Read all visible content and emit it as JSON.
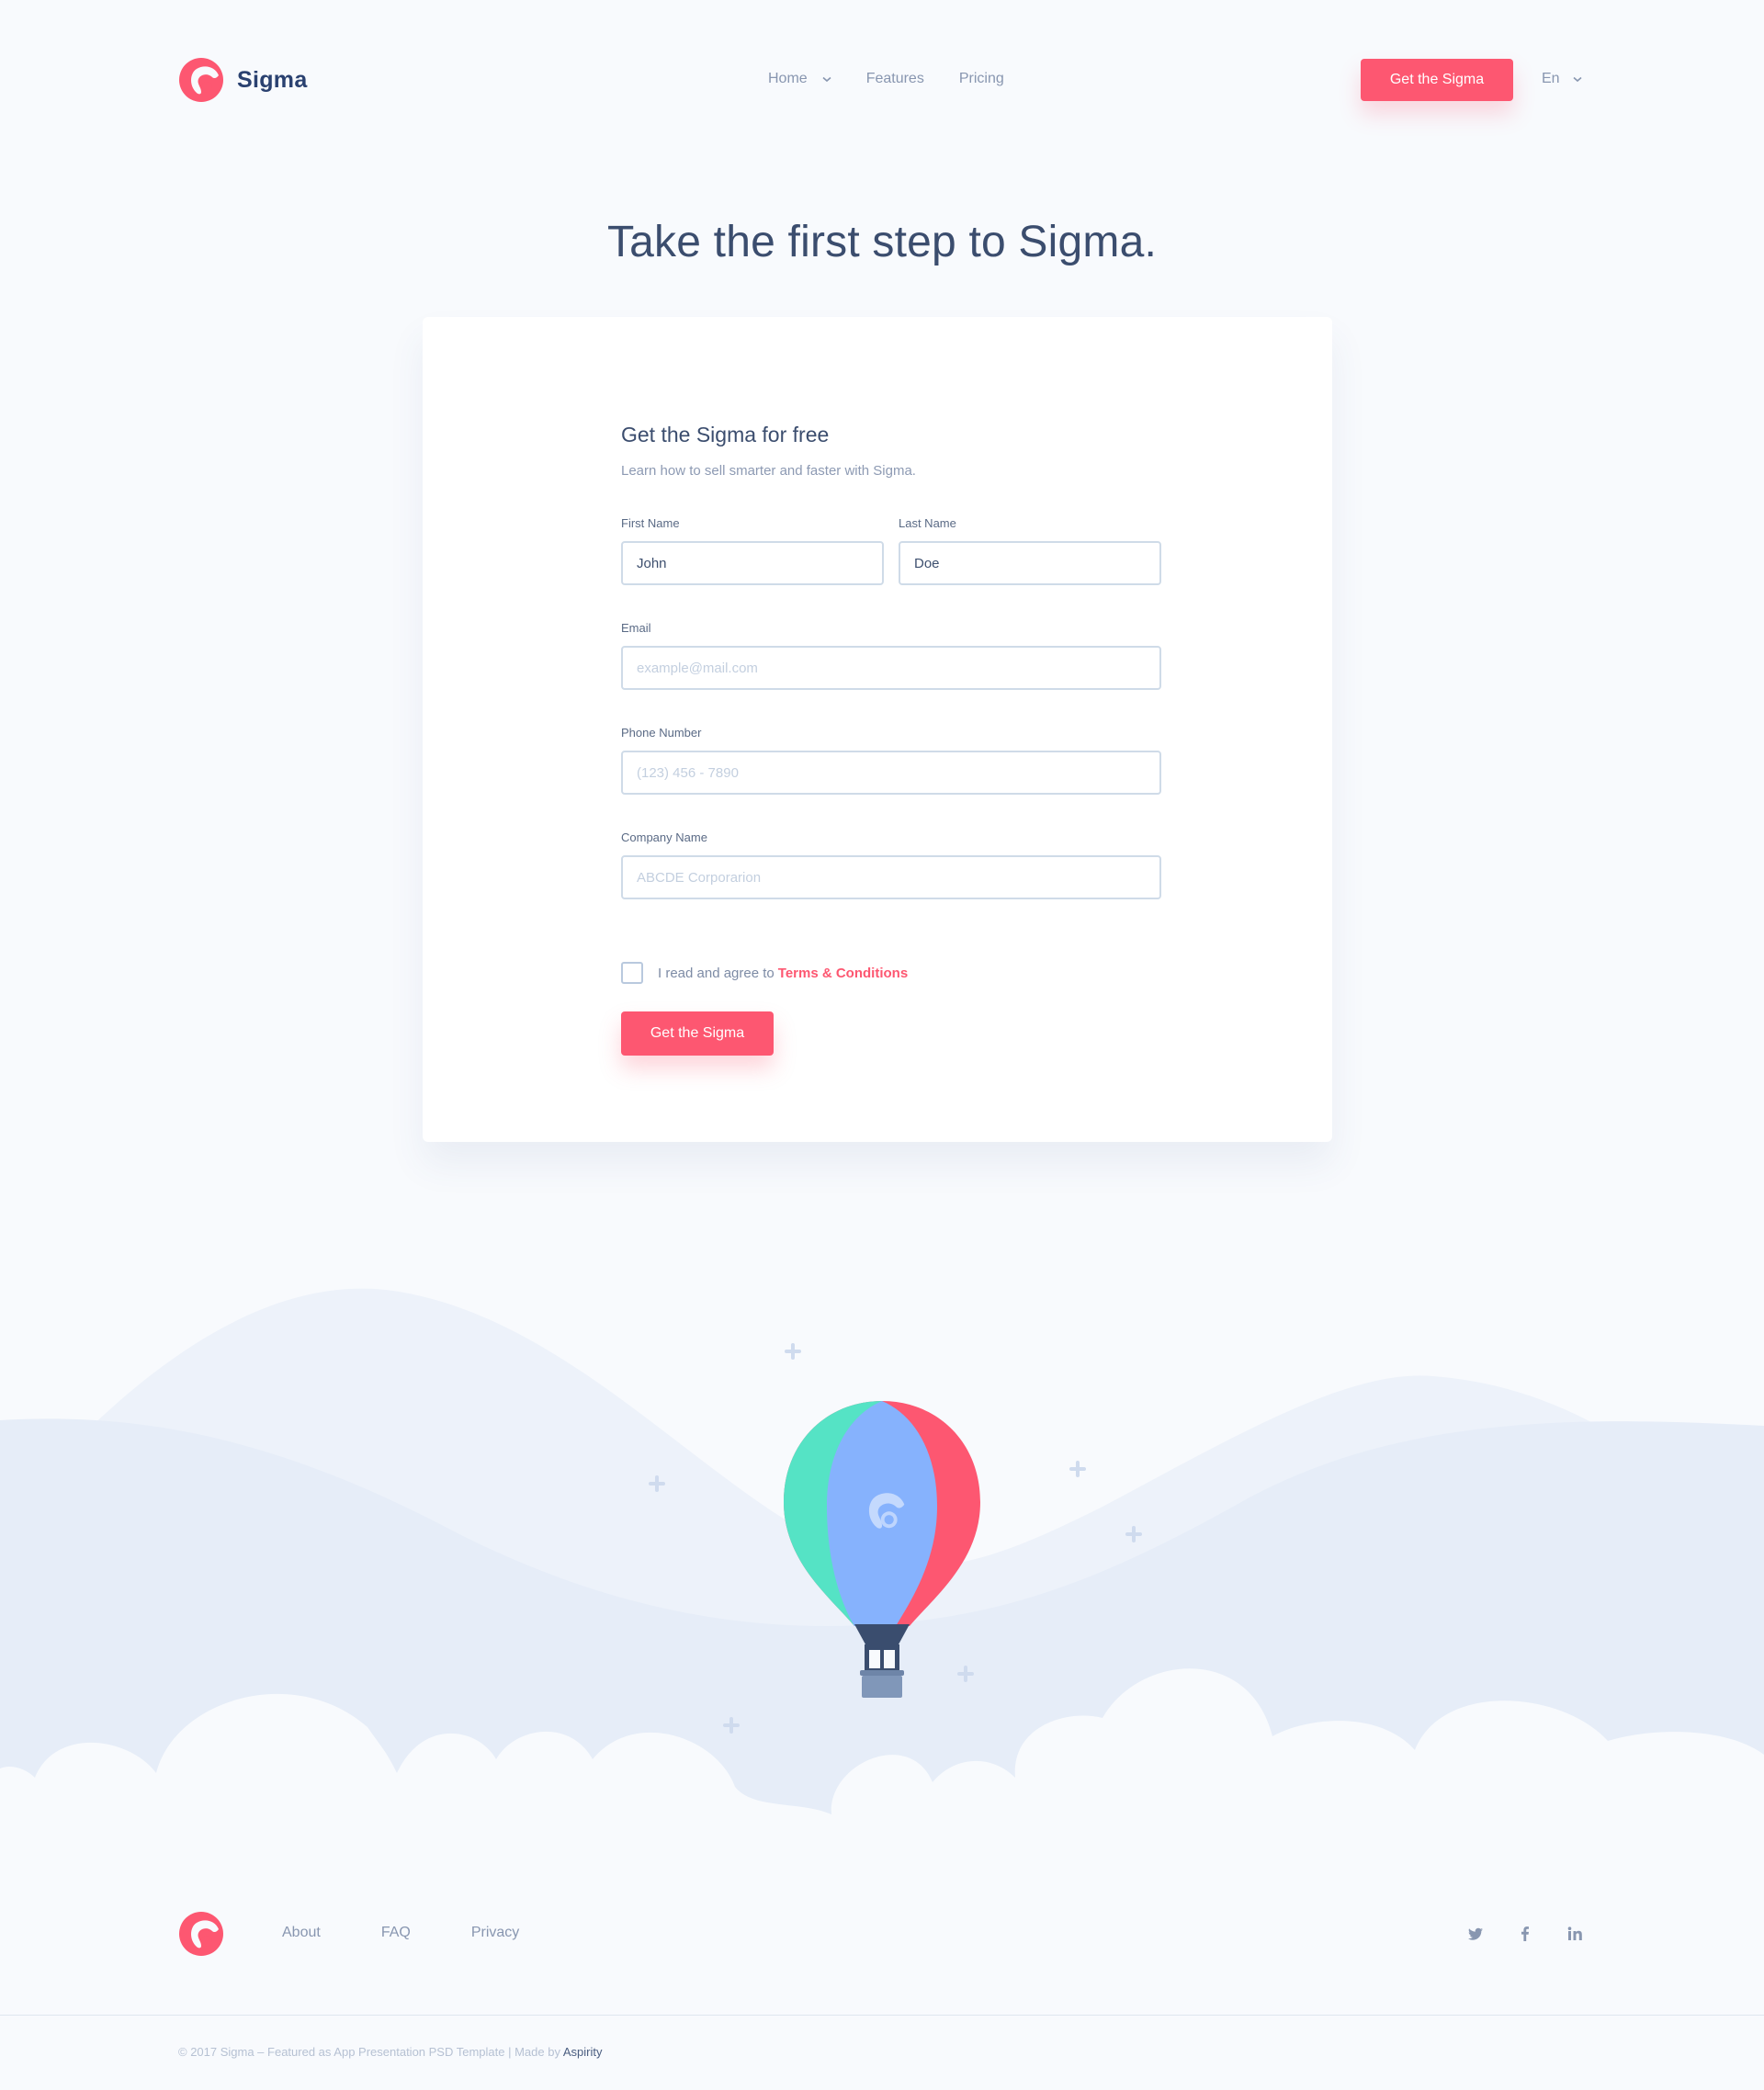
{
  "brand": {
    "name": "Sigma",
    "accent": "#fd5771",
    "logo_icon": "sigma-logo-icon"
  },
  "nav": {
    "items": [
      {
        "label": "Home",
        "has_dropdown": true
      },
      {
        "label": "Features"
      },
      {
        "label": "Pricing"
      }
    ],
    "cta_label": "Get the Sigma",
    "language": "En"
  },
  "hero": {
    "title": "Take the first step to Sigma."
  },
  "form": {
    "title": "Get the Sigma for free",
    "subtitle": "Learn how to sell smarter and faster with Sigma.",
    "first_name": {
      "label": "First Name",
      "value": "John"
    },
    "last_name": {
      "label": "Last Name",
      "value": "Doe"
    },
    "email": {
      "label": "Email",
      "placeholder": "example@mail.com"
    },
    "phone": {
      "label": "Phone Number",
      "placeholder": "(123) 456 - 7890"
    },
    "company": {
      "label": "Company Name",
      "placeholder": "ABCDE Corporarion"
    },
    "agree_text": "I read and agree to",
    "terms_label": "Terms & Conditions",
    "submit_label": "Get the Sigma"
  },
  "illustration": {
    "icon": "hot-air-balloon-icon"
  },
  "footer": {
    "links": [
      "About",
      "FAQ",
      "Privacy"
    ],
    "social": [
      "twitter-icon",
      "facebook-icon",
      "linkedin-icon"
    ],
    "copyright": "© 2017 Sigma – Featured as App Presentation PSD Template  |  Made by",
    "maker": "Aspirity"
  }
}
